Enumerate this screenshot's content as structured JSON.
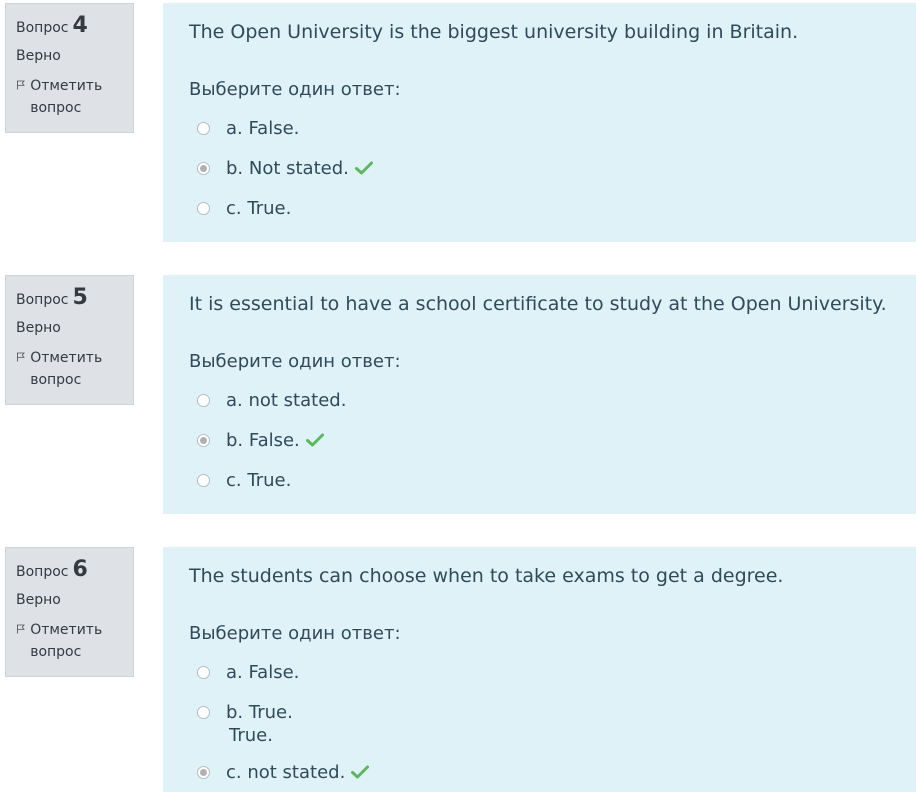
{
  "questions": [
    {
      "label": "Вопрос",
      "number": "4",
      "state": "Верно",
      "flag_label": "Отметить вопрос",
      "text": "The Open University is the biggest university building in Britain.",
      "prompt": "Выберите один ответ:",
      "answers": [
        {
          "label": "a. False.",
          "checked": false,
          "correct": false
        },
        {
          "label": "b. Not stated.",
          "checked": true,
          "correct": true
        },
        {
          "label": "c. True.",
          "checked": false,
          "correct": false
        }
      ]
    },
    {
      "label": "Вопрос",
      "number": "5",
      "state": "Верно",
      "flag_label": "Отметить вопрос",
      "text": "It is essential to have a school certificate to study at the Open University.",
      "prompt": "Выберите один ответ:",
      "answers": [
        {
          "label": "a. not stated.",
          "checked": false,
          "correct": false
        },
        {
          "label": "b. False.",
          "checked": true,
          "correct": true
        },
        {
          "label": "c. True.",
          "checked": false,
          "correct": false
        }
      ]
    },
    {
      "label": "Вопрос",
      "number": "6",
      "state": "Верно",
      "flag_label": "Отметить вопрос",
      "text": "The students can choose  when to take exams to get a degree.",
      "prompt": "Выберите один ответ:",
      "answers": [
        {
          "label": "a. False.",
          "checked": false,
          "correct": false
        },
        {
          "label": "b. True.",
          "checked": false,
          "correct": false,
          "extra": "True."
        },
        {
          "label": "c. not stated.",
          "checked": true,
          "correct": true
        }
      ]
    }
  ],
  "colors": {
    "info_bg": "#dee2e6",
    "content_bg": "#def2f8",
    "check_green": "#5cb85c"
  },
  "icons": {
    "flag": "flag-icon",
    "correct": "check-icon"
  }
}
